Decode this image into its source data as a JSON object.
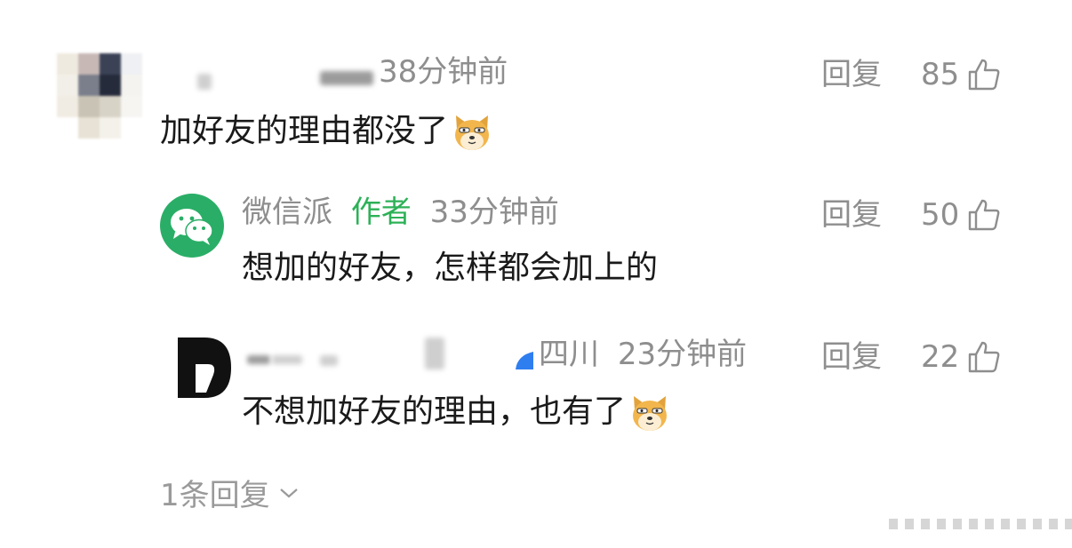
{
  "comments": [
    {
      "time": "38分钟前",
      "text": "加好友的理由都没了",
      "reply_label": "回复",
      "likes": "85"
    },
    {
      "username": "微信派",
      "author_tag": "作者",
      "time": "33分钟前",
      "text": "想加的好友，怎样都会加上的",
      "reply_label": "回复",
      "likes": "50"
    },
    {
      "location": "四川",
      "time": "23分钟前",
      "text": "不想加好友的理由，也有了",
      "reply_label": "回复",
      "likes": "22"
    }
  ],
  "more_replies": "1条回复",
  "colors": {
    "author_green": "#2db157",
    "meta_gray": "#8e8e8e",
    "wechat_green": "#2aae67"
  },
  "icons": [
    "thumbs-up-icon",
    "doge-emoji-icon",
    "wechat-logo-icon",
    "chevron-down-icon"
  ]
}
